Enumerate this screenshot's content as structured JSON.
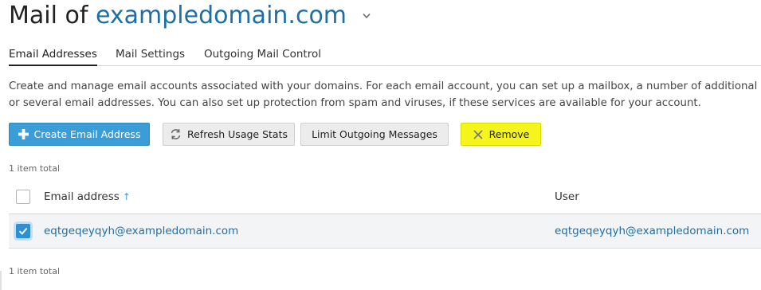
{
  "header": {
    "title_prefix": "Mail of",
    "domain": "exampledomain.com"
  },
  "tabs": [
    {
      "label": "Email Addresses",
      "active": true
    },
    {
      "label": "Mail Settings",
      "active": false
    },
    {
      "label": "Outgoing Mail Control",
      "active": false
    }
  ],
  "description": {
    "line1": "Create and manage email accounts associated with your domains. For each email account, you can set up a mailbox, a number of additional ema",
    "line2": "or several email addresses. You can also set up protection from spam and viruses, if these services are available for your account."
  },
  "toolbar": {
    "create_label": "Create Email Address",
    "refresh_label": "Refresh Usage Stats",
    "limit_label": "Limit Outgoing Messages",
    "remove_label": "Remove"
  },
  "list": {
    "count_top": "1 item total",
    "count_bottom": "1 item total",
    "columns": {
      "email": "Email address",
      "sort_indicator": "↑",
      "user": "User"
    },
    "rows": [
      {
        "email": "eqtgeqeyqyh@exampledomain.com",
        "user": "eqtgeqeyqyh@exampledomain.com",
        "checked": true
      }
    ]
  },
  "colors": {
    "accent": "#3a9dd8",
    "link": "#1d6fa5",
    "highlight": "#f5f51e"
  },
  "icons": {
    "chevron": "chevron-down-icon",
    "create": "plus-icon",
    "refresh": "refresh-icon",
    "remove": "remove-x-icon",
    "checkbox": "checkmark-icon"
  }
}
